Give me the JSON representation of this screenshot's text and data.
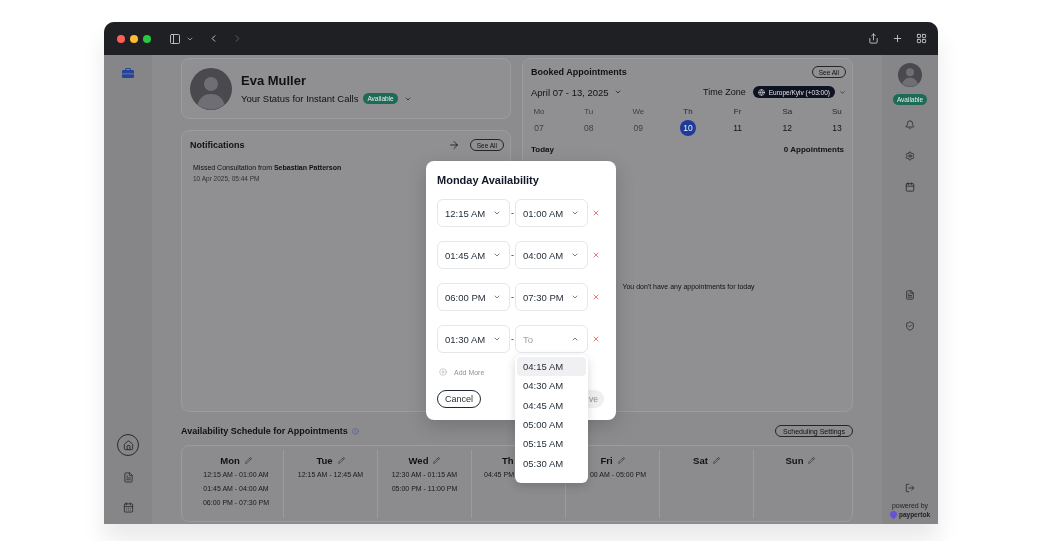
{
  "left_nav": [
    {
      "selected": true
    },
    {
      "selected": false
    },
    {
      "selected": false
    },
    {
      "selected": false
    }
  ],
  "profile": {
    "name": "Eva Muller",
    "status_label": "Your Status for Instant Calls",
    "status": "Available"
  },
  "notifications": {
    "title": "Notifications",
    "see_all": "See All",
    "items": [
      {
        "text": "Missed Consultation from **Sebastian Patterson**",
        "time": "10 Apr 2025, 05:44 PM"
      }
    ]
  },
  "booked_appointments": {
    "title": "Booked Appointments",
    "see_all": "See All",
    "range": "April 07 - 13, 2025",
    "time_zone_label": "Time Zone",
    "time_zone": "Europe/Kyiv (+03:00)",
    "week": [
      {
        "day": "Mo",
        "date": "07",
        "disabled": true,
        "selected": false
      },
      {
        "day": "Tu",
        "date": "08",
        "disabled": true,
        "selected": false
      },
      {
        "day": "We",
        "date": "09",
        "disabled": true,
        "selected": false
      },
      {
        "day": "Th",
        "date": "10",
        "disabled": false,
        "selected": true
      },
      {
        "day": "Fr",
        "date": "11",
        "disabled": false,
        "selected": false
      },
      {
        "day": "Sa",
        "date": "12",
        "disabled": false,
        "selected": false
      },
      {
        "day": "Su",
        "date": "13",
        "disabled": false,
        "selected": false
      }
    ],
    "today_label": "Today",
    "count": "0 Appointments",
    "empty_message": "You don't have any appointments for today"
  },
  "availability_schedule": {
    "title": "Availability Schedule for Appointments",
    "settings_button": "Scheduling Settings",
    "days": [
      {
        "day": "Mon",
        "slots": [
          "12:15 AM - 01:00 AM",
          "01:45 AM - 04:00 AM",
          "06:00 PM - 07:30 PM"
        ]
      },
      {
        "day": "Tue",
        "slots": [
          "12:15 AM - 12:45 AM"
        ]
      },
      {
        "day": "Wed",
        "slots": [
          "12:30 AM - 01:15 AM",
          "05:00 PM - 11:00 PM"
        ]
      },
      {
        "day": "Th",
        "slots": [
          "04:45 PM"
        ]
      },
      {
        "day": "Fri",
        "slots": [
          "00 AM - 05:00 PM"
        ]
      },
      {
        "day": "Sat"
      },
      {
        "day": "Sun"
      }
    ]
  },
  "right_rail": {
    "status": "Available",
    "powered_by": "powered by",
    "brand": "paypertok"
  },
  "modal": {
    "title": "Monday Availability",
    "rows": [
      {
        "from": {
          "value": "12:15 AM",
          "expanded": false
        },
        "separator": "-",
        "to": {
          "value": "01:00 AM",
          "expanded": false
        }
      },
      {
        "from": {
          "value": "01:45 AM",
          "expanded": false
        },
        "separator": "-",
        "to": {
          "value": "04:00 AM",
          "expanded": false
        }
      },
      {
        "from": {
          "value": "06:00 PM",
          "expanded": false
        },
        "separator": "-",
        "to": {
          "value": "07:30 PM",
          "expanded": false
        }
      },
      {
        "from": {
          "value": "01:30 AM",
          "expanded": false
        },
        "separator": "-",
        "to": {
          "placeholder": "To",
          "expanded": true,
          "options": [
            {
              "label": "04:15 AM",
              "selected": true
            },
            {
              "label": "04:30 AM",
              "selected": false
            },
            {
              "label": "04:45 AM",
              "selected": false
            },
            {
              "label": "05:00 AM",
              "selected": false
            },
            {
              "label": "05:15 AM",
              "selected": false
            },
            {
              "label": "05:30 AM",
              "selected": false
            }
          ]
        }
      }
    ],
    "add_more": {
      "label": "Add More",
      "disabled": true
    },
    "buttons": [
      {
        "label": "Cancel",
        "kind": "outline",
        "disabled": false
      },
      {
        "label": "ve",
        "kind": "primary",
        "disabled": true
      }
    ]
  }
}
